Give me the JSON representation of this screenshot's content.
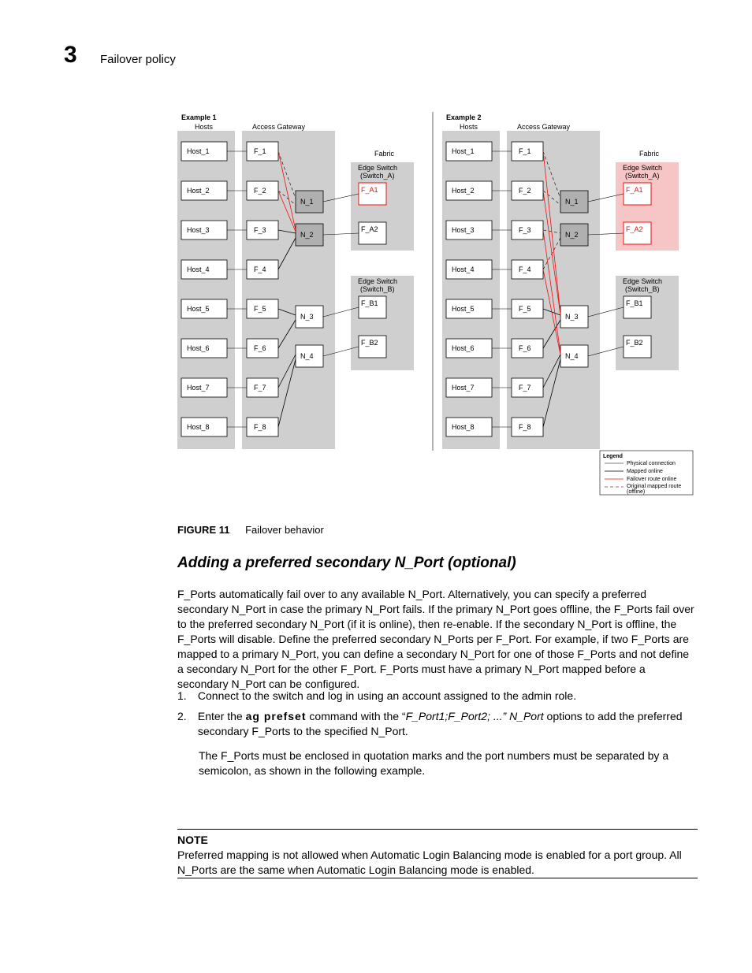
{
  "chapterNum": "3",
  "chapterTitle": "Failover policy",
  "figureLabel": "FIGURE 11",
  "figureCaption": "Failover behavior",
  "heading2": "Adding a preferred secondary N_Port (optional)",
  "para1": "F_Ports automatically fail over to any available N_Port. Alternatively, you can specify a preferred secondary N_Port in case the primary N_Port fails. If the primary N_Port goes offline, the F_Ports fail over to the preferred secondary N_Port (if it is online), then re-enable. If the secondary N_Port is offline, the F_Ports will disable. Define the preferred secondary N_Ports per F_Port. For example, if two F_Ports are mapped to a primary N_Port, you can define a secondary N_Port for one of those F_Ports and not define a secondary N_Port for the other F_Port. F_Ports must have a primary N_Port mapped before a secondary N_Port can be configured.",
  "list": {
    "n1": "1.",
    "t1": "Connect to the switch and log in using an account assigned to the admin role.",
    "n2": "2.",
    "t2a": "Enter the ",
    "cmd": "ag   prefset",
    "t2b": " command with the “",
    "t2i": "F_Port1;F_Port2; ...” N_Port",
    "t2c": " options to add the preferred secondary F_Ports to the specified N_Port.",
    "t2d": "The F_Ports must be enclosed in quotation marks and the port numbers must be separated by a semicolon, as shown in the following example."
  },
  "noteHd": "NOTE",
  "noteBody": "Preferred mapping is not allowed when Automatic Login Balancing mode is enabled for a port group. All N_Ports are the same when Automatic Login Balancing mode is enabled.",
  "diagram": {
    "ex1": "Example 1",
    "ex2": "Example 2",
    "hosts": "Hosts",
    "ag": "Access Gateway",
    "fabric": "Fabric",
    "esA": "Edge Switch",
    "esA2": "(Switch_A)",
    "esB": "Edge Switch",
    "esB2": "(Switch_B)",
    "host": [
      "Host_1",
      "Host_2",
      "Host_3",
      "Host_4",
      "Host_5",
      "Host_6",
      "Host_7",
      "Host_8"
    ],
    "fport": [
      "F_1",
      "F_2",
      "F_3",
      "F_4",
      "F_5",
      "F_6",
      "F_7",
      "F_8"
    ],
    "nport": [
      "N_1",
      "N_2",
      "N_3",
      "N_4"
    ],
    "fa": [
      "F_A1",
      "F_A2"
    ],
    "fb": [
      "F_B1",
      "F_B2"
    ],
    "legend": {
      "title": "Legend",
      "l1": "Physical connection",
      "l2": "Mapped online",
      "l3": "Failover route online",
      "l4": "Original mapped route",
      "l5": "(offline)"
    }
  }
}
